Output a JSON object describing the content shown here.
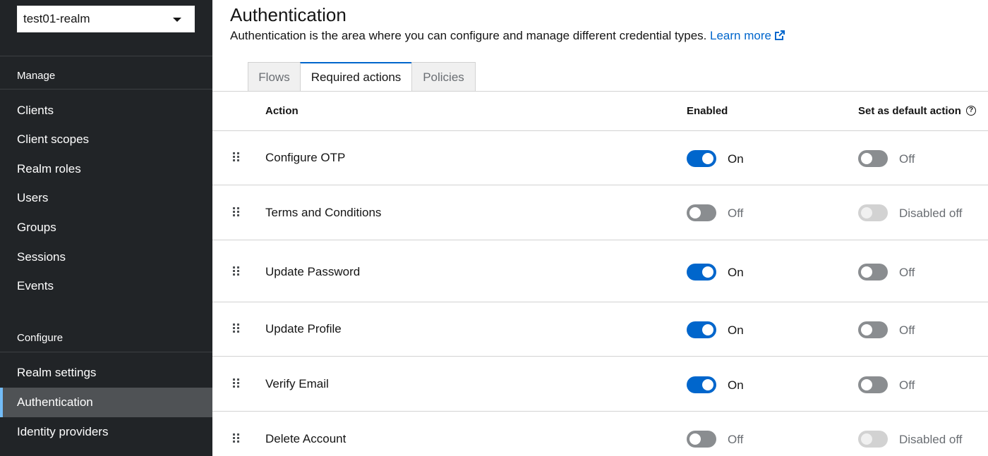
{
  "sidebar": {
    "realm": "test01-realm",
    "manage_title": "Manage",
    "manage_items": [
      "Clients",
      "Client scopes",
      "Realm roles",
      "Users",
      "Groups",
      "Sessions",
      "Events"
    ],
    "configure_title": "Configure",
    "configure_items": [
      "Realm settings",
      "Authentication",
      "Identity providers"
    ],
    "active_item": "Authentication"
  },
  "header": {
    "title": "Authentication",
    "description": "Authentication is the area where you can configure and manage different credential types.",
    "learn_more": "Learn more"
  },
  "tabs": [
    {
      "label": "Flows",
      "active": false
    },
    {
      "label": "Required actions",
      "active": true
    },
    {
      "label": "Policies",
      "active": false
    }
  ],
  "table": {
    "columns": [
      "Action",
      "Enabled",
      "Set as default action"
    ],
    "rows": [
      {
        "action": "Configure OTP",
        "enabled": true,
        "enabled_label": "On",
        "default_state": "off",
        "default_label": "Off"
      },
      {
        "action": "Terms and Conditions",
        "enabled": false,
        "enabled_label": "Off",
        "default_state": "disabled",
        "default_label": "Disabled off"
      },
      {
        "action": "Update Password",
        "enabled": true,
        "enabled_label": "On",
        "default_state": "off",
        "default_label": "Off"
      },
      {
        "action": "Update Profile",
        "enabled": true,
        "enabled_label": "On",
        "default_state": "off",
        "default_label": "Off"
      },
      {
        "action": "Verify Email",
        "enabled": true,
        "enabled_label": "On",
        "default_state": "off",
        "default_label": "Off"
      },
      {
        "action": "Delete Account",
        "enabled": false,
        "enabled_label": "Off",
        "default_state": "disabled",
        "default_label": "Disabled off"
      }
    ]
  },
  "colors": {
    "sidebar_bg": "#212427",
    "active_nav_bg": "#4f5255",
    "accent": "#0066cc",
    "switch_off": "#8a8d90",
    "switch_disabled": "#d2d2d2"
  },
  "icons": {
    "realm_dropdown": "caret-down-icon",
    "learn_more": "external-link-icon",
    "help": "help-circle-icon",
    "drag": "drag-handle-icon"
  }
}
